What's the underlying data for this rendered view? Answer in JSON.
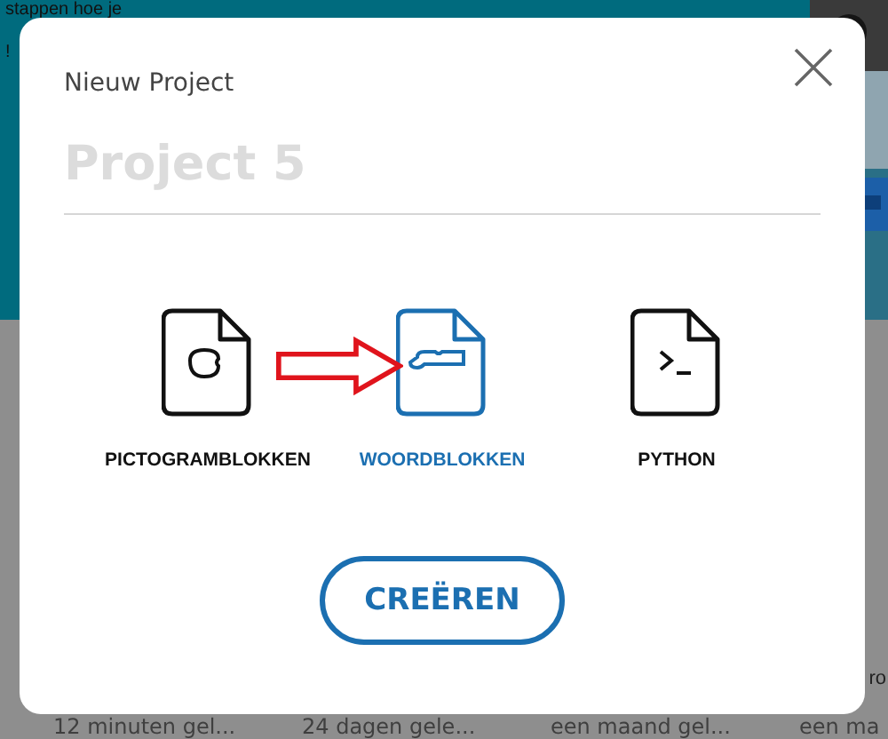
{
  "background": {
    "hero_lines": [
      "stappen hoe je",
      "!"
    ],
    "side_title": "ro",
    "card_times": [
      "12 minuten gel...",
      "24 dagen gele...",
      "een maand gel...",
      "een ma"
    ]
  },
  "dialog": {
    "title": "Nieuw Project",
    "name_field": {
      "placeholder": "Project 5"
    },
    "types": [
      {
        "kind": "pictogram",
        "label": "PICTOGRAMBLOKKEN",
        "selected": false
      },
      {
        "kind": "word",
        "label": "WOORDBLOKKEN",
        "selected": true
      },
      {
        "kind": "python",
        "label": "PYTHON",
        "selected": false
      }
    ],
    "create_button": "CREËREN"
  }
}
